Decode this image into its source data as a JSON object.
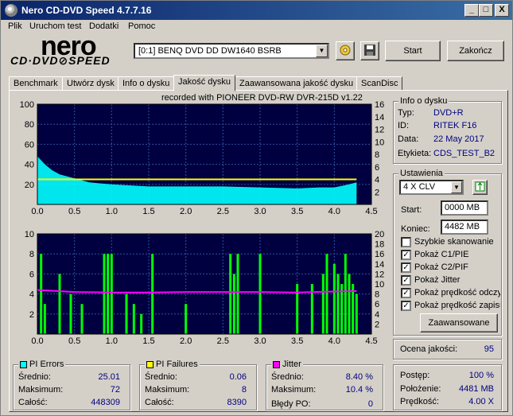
{
  "window": {
    "title": "Nero CD-DVD Speed 4.7.7.16",
    "min": "_",
    "max": "□",
    "close": "X"
  },
  "menu": [
    "Plik",
    "Uruchom test",
    "Dodatki",
    "Pomoc"
  ],
  "logo": {
    "brand": "nero",
    "product": "CD·DVD⊘SPEED"
  },
  "drive": {
    "selected": "[0:1]   BENQ DVD DD DW1640 BSRB"
  },
  "toolbar": {
    "start": "Start",
    "end": "Zakończ",
    "icons": [
      "disc-eject-icon",
      "save-icon"
    ]
  },
  "tabs": [
    "Benchmark",
    "Utwórz dysk",
    "Info o dysku",
    "Jakość dysku",
    "Zaawansowana jakość dysku",
    "ScanDisc"
  ],
  "active_tab": "Jakość dysku",
  "recorded_with": "recorded with PIONEER DVD-RW  DVR-215D v1.22",
  "disc_info": {
    "title": "Info o dysku",
    "rows": [
      {
        "label": "Typ:",
        "value": "DVD+R"
      },
      {
        "label": "ID:",
        "value": "RITEK F16"
      },
      {
        "label": "Data:",
        "value": "22 May 2017"
      },
      {
        "label": "Etykieta:",
        "value": "CDS_TEST_B2"
      }
    ]
  },
  "settings": {
    "title": "Ustawienia",
    "speed": "4 X CLV",
    "start_label": "Start:",
    "start_value": "0000 MB",
    "end_label": "Koniec:",
    "end_value": "4482 MB",
    "checkboxes": [
      {
        "label": "Szybkie skanowanie",
        "checked": false
      },
      {
        "label": "Pokaż C1/PIE",
        "checked": true
      },
      {
        "label": "Pokaż C2/PIF",
        "checked": true
      },
      {
        "label": "Pokaż Jitter",
        "checked": true
      },
      {
        "label": "Pokaż prędkość odczy",
        "checked": true
      },
      {
        "label": "Pokaż prędkość zapisu",
        "checked": true
      }
    ],
    "advanced_button": "Zaawansowane"
  },
  "quality": {
    "label": "Ocena jakości:",
    "value": "95"
  },
  "progress": {
    "rows": [
      {
        "label": "Postęp:",
        "value": "100 %"
      },
      {
        "label": "Położenie:",
        "value": "4481 MB"
      },
      {
        "label": "Prędkość:",
        "value": "4.00 X"
      }
    ]
  },
  "pi_errors": {
    "title": "PI Errors",
    "color": "#00ffff",
    "rows": [
      {
        "label": "Średnio:",
        "value": "25.01"
      },
      {
        "label": "Maksimum:",
        "value": "72"
      },
      {
        "label": "Całość:",
        "value": "448309"
      }
    ]
  },
  "pi_failures": {
    "title": "PI Failures",
    "color": "#ffff00",
    "rows": [
      {
        "label": "Średnio:",
        "value": "0.06"
      },
      {
        "label": "Maksimum:",
        "value": "8"
      },
      {
        "label": "Całość:",
        "value": "8390"
      }
    ]
  },
  "jitter": {
    "title": "Jitter",
    "color": "#ff00ff",
    "rows": [
      {
        "label": "Średnio:",
        "value": "8.40 %"
      },
      {
        "label": "Maksimum:",
        "value": "10.4 %"
      }
    ],
    "po_label": "Błędy PO:",
    "po_value": "0"
  },
  "chart_data": [
    {
      "type": "area",
      "background": "#000040",
      "x_ticks": [
        "0.0",
        "0.5",
        "1.0",
        "1.5",
        "2.0",
        "2.5",
        "3.0",
        "3.5",
        "4.0",
        "4.5"
      ],
      "y_left_ticks": [
        "100",
        "80",
        "60",
        "40",
        "20"
      ],
      "y_right_ticks": [
        "16",
        "14",
        "12",
        "10",
        "8",
        "6",
        "4",
        "2"
      ],
      "xlim": [
        0,
        4.5
      ],
      "ylim_left": [
        0,
        100
      ],
      "ylim_right": [
        0,
        16
      ],
      "series": [
        {
          "values_x": [
            0.0,
            0.05,
            0.1,
            0.2,
            0.3,
            0.4,
            0.5,
            0.7,
            1.0,
            1.5,
            2.0,
            2.5,
            3.0,
            3.5,
            3.8,
            4.0,
            4.2,
            4.3
          ],
          "values_y": [
            48,
            44,
            40,
            34,
            30,
            28,
            26,
            22,
            20,
            18,
            18,
            18,
            17,
            16,
            17,
            17,
            20,
            22
          ],
          "color": "#00ffff"
        },
        {
          "values_x": [
            0.0,
            1.0,
            2.0,
            3.0,
            4.0,
            4.3
          ],
          "values_y": [
            4,
            4,
            4,
            4,
            4,
            4
          ],
          "color": "#ffff00",
          "axis": "right"
        }
      ]
    },
    {
      "type": "bar",
      "background": "#000040",
      "x_ticks": [
        "0.0",
        "0.5",
        "1.0",
        "1.5",
        "2.0",
        "2.5",
        "3.0",
        "3.5",
        "4.0",
        "4.5"
      ],
      "y_left_ticks": [
        "10",
        "8",
        "6",
        "4",
        "2"
      ],
      "y_right_ticks": [
        "20",
        "18",
        "16",
        "14",
        "12",
        "10",
        "8",
        "6",
        "4",
        "2"
      ],
      "xlim": [
        0,
        4.5
      ],
      "ylim_left": [
        0,
        10
      ],
      "ylim_right": [
        0,
        20
      ],
      "series": [
        {
          "bars_x": [
            0.05,
            0.1,
            0.3,
            0.45,
            0.6,
            0.9,
            0.95,
            1.0,
            1.2,
            1.3,
            1.4,
            1.55,
            2.0,
            2.6,
            2.65,
            2.7,
            3.0,
            3.5,
            3.7,
            3.85,
            3.9,
            4.0,
            4.05,
            4.1,
            4.15,
            4.2,
            4.25,
            4.3
          ],
          "bars_y": [
            8,
            3,
            6,
            4,
            3,
            8,
            8,
            8,
            4,
            3,
            2,
            8,
            3,
            8,
            6,
            8,
            8,
            5,
            5,
            6,
            8,
            7,
            6,
            5,
            8,
            6,
            5,
            4
          ],
          "color": "#00ff00"
        },
        {
          "values_x": [
            0.0,
            0.5,
            1.0,
            1.5,
            2.0,
            2.5,
            3.0,
            3.5,
            4.0,
            4.3
          ],
          "values_y": [
            8.8,
            8.4,
            8.3,
            8.3,
            8.4,
            8.4,
            8.4,
            8.3,
            8.5,
            8.6
          ],
          "color": "#ff00ff",
          "axis": "right"
        }
      ]
    }
  ]
}
